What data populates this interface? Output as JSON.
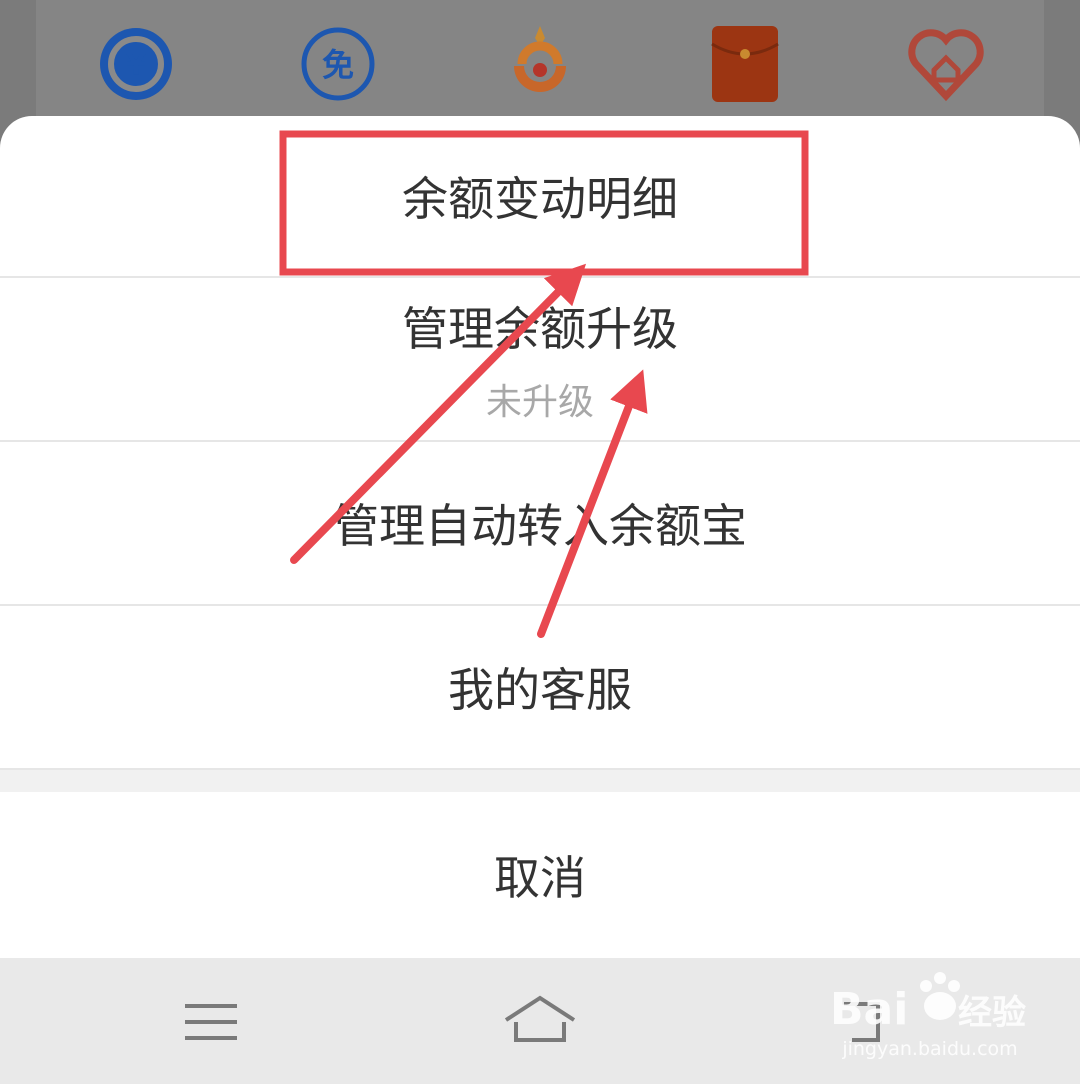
{
  "background_icons": [
    {
      "name": "yuan-refresh-icon",
      "glyph": "¥",
      "color": "#1e5bb8"
    },
    {
      "name": "free-badge-icon",
      "glyph": "免",
      "color": "#1e5bb8"
    },
    {
      "name": "orange-emblem-icon",
      "color": "#d9762b"
    },
    {
      "name": "red-envelope-icon",
      "color": "#b23d12"
    },
    {
      "name": "heart-home-icon",
      "color": "#c04a3c"
    }
  ],
  "sheet": {
    "items": [
      {
        "label": "余额变动明细"
      },
      {
        "label": "管理余额升级",
        "sublabel": "未升级"
      },
      {
        "label": "管理自动转入余额宝"
      },
      {
        "label": "我的客服"
      }
    ],
    "cancel_label": "取消"
  },
  "navbar": {
    "buttons": [
      "menu-icon",
      "home-icon",
      "back-icon"
    ]
  },
  "annotation": {
    "color": "#e8484f"
  },
  "watermark": {
    "text": "jingyan.baidu.com",
    "brand": "Baidu 经验"
  }
}
